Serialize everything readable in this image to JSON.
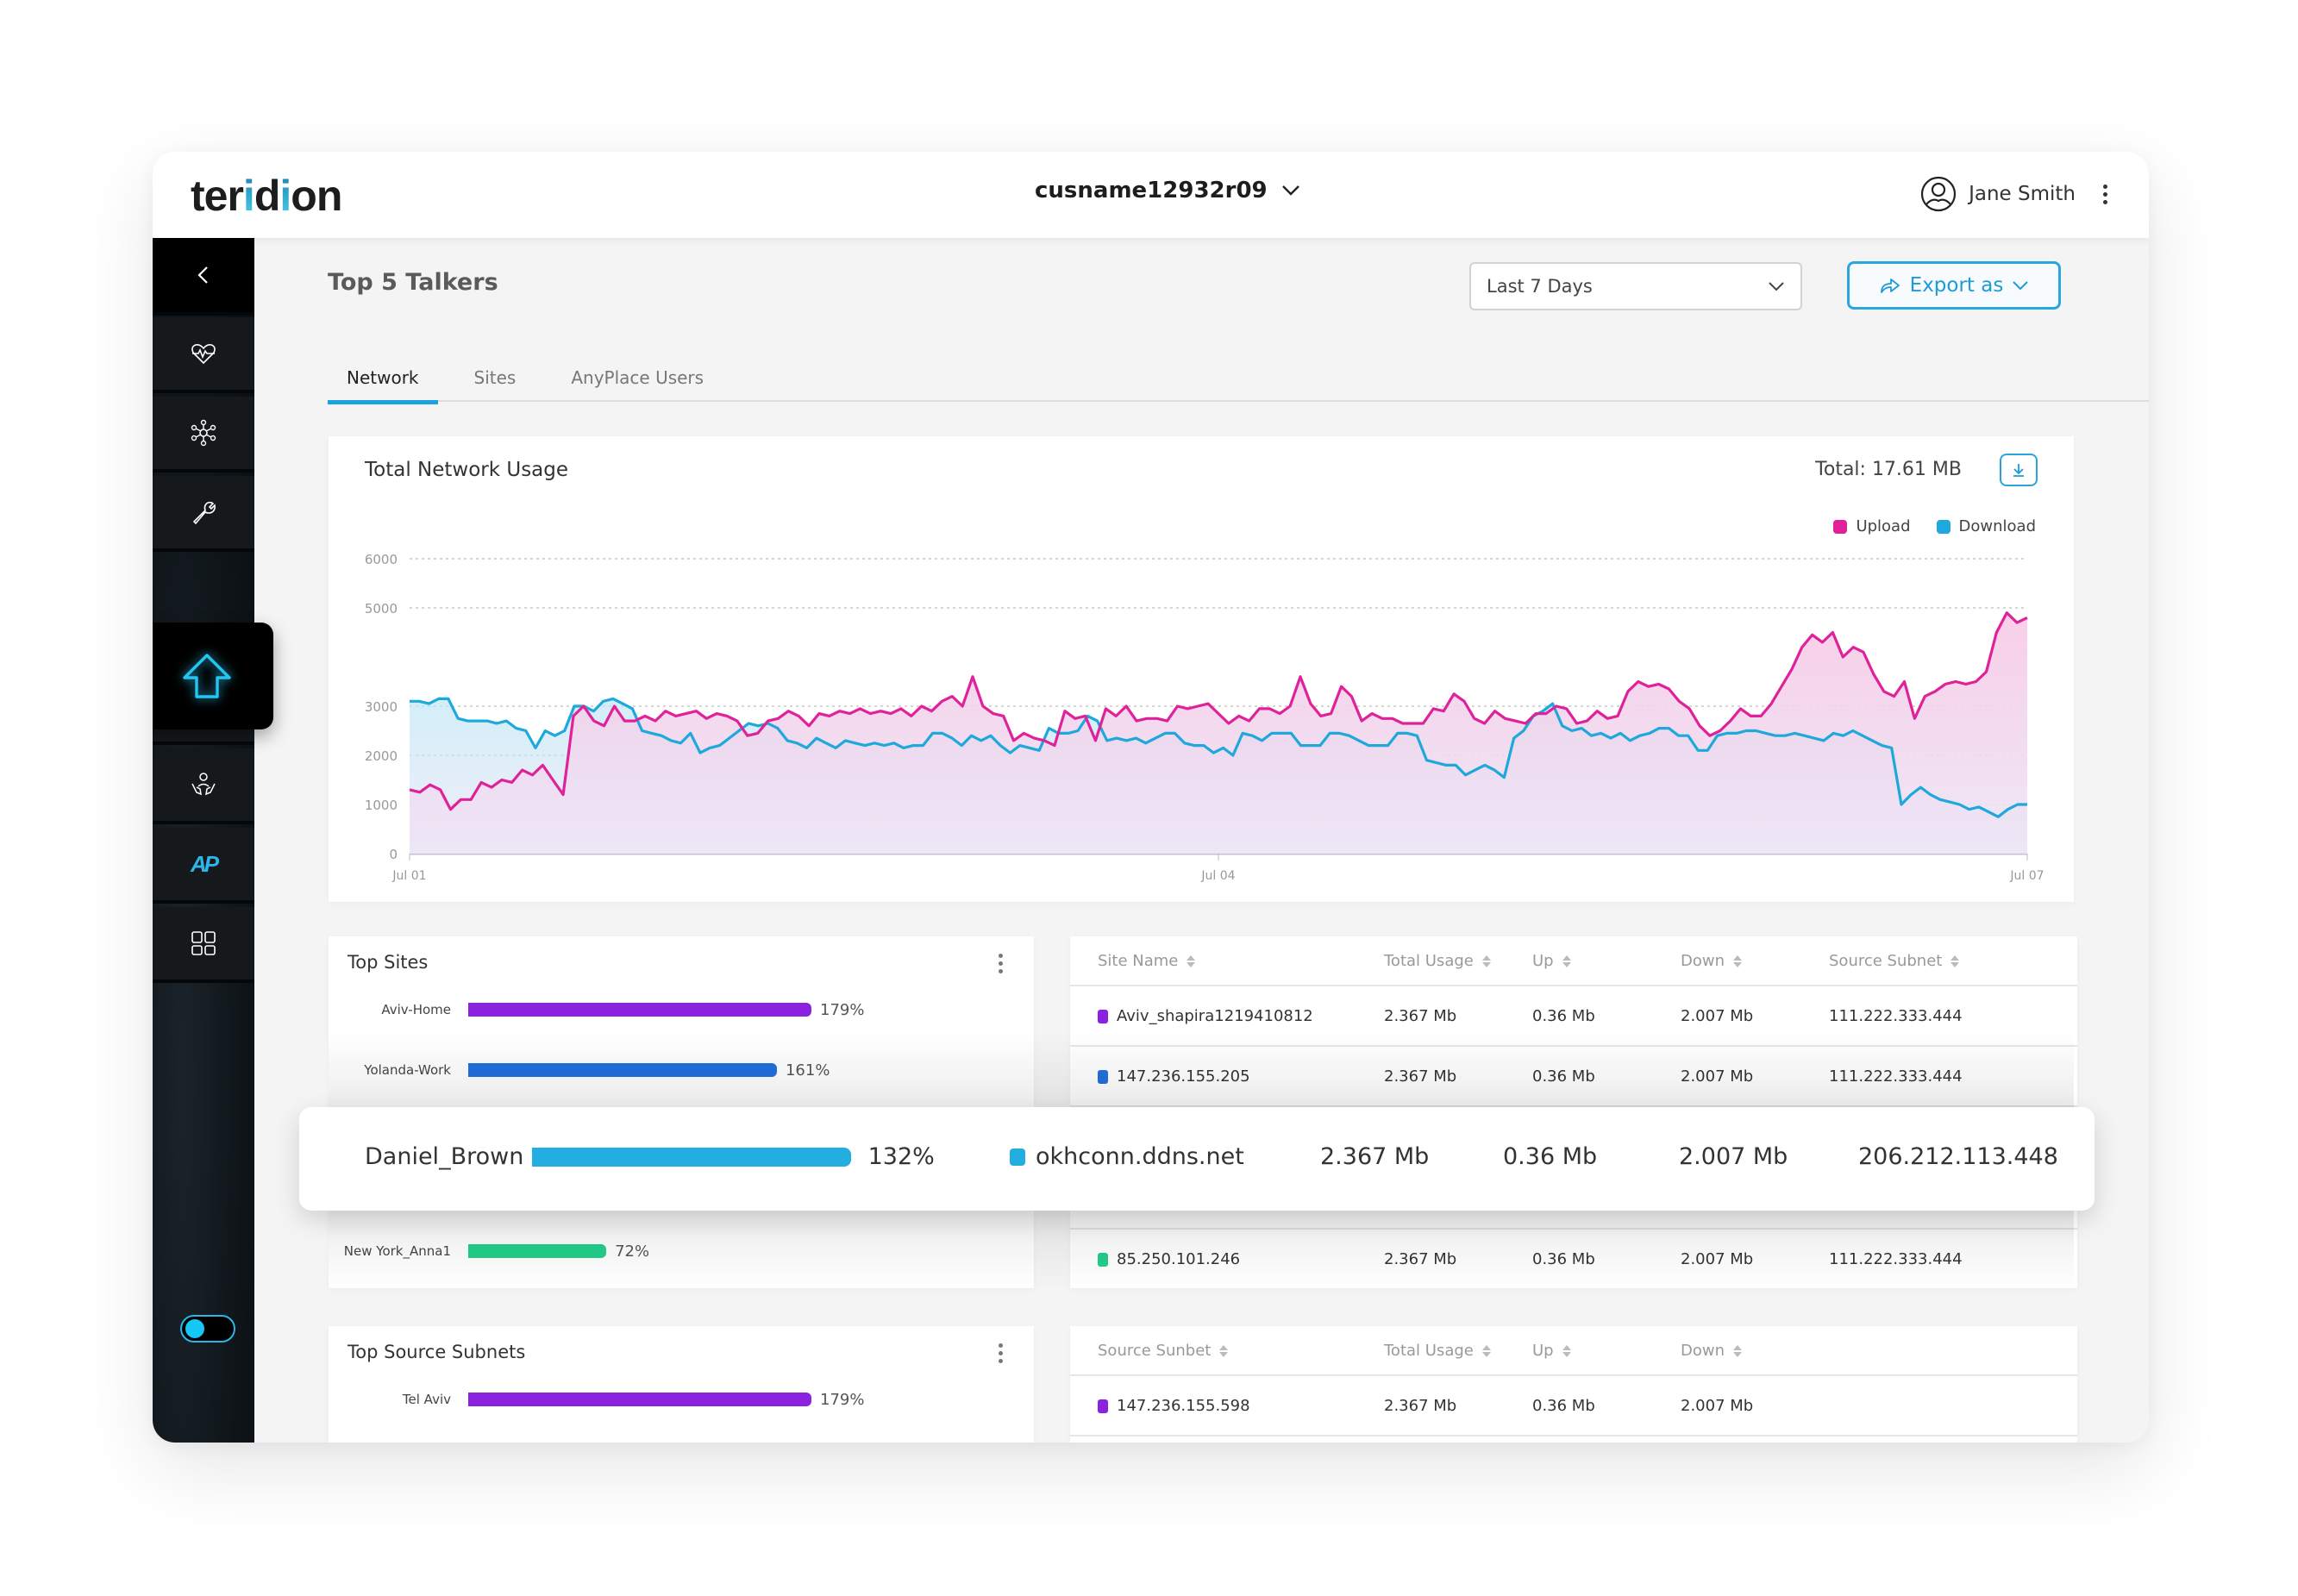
{
  "brand": {
    "name_pre": "ter",
    "name_i1": "i",
    "name_mid": "d",
    "name_i2": "i",
    "name_post": "on"
  },
  "header": {
    "tenant": "cusname12932r09",
    "user_name": "Jane Smith"
  },
  "sidebar": {
    "items": [
      {
        "name": "back",
        "icon": "chevron-left-icon"
      },
      {
        "name": "health",
        "icon": "heart-pulse-icon"
      },
      {
        "name": "network",
        "icon": "network-nodes-icon"
      },
      {
        "name": "tools",
        "icon": "wrench-icon"
      },
      {
        "name": "top-talkers",
        "icon": "arrow-up-icon",
        "active": true
      },
      {
        "name": "users",
        "icon": "users-group-icon"
      },
      {
        "name": "support",
        "icon": "hands-user-icon"
      },
      {
        "name": "anyplace",
        "icon": "ap-logo-icon",
        "label": "AP"
      },
      {
        "name": "apps",
        "icon": "grid-icon"
      }
    ],
    "toggle_on": true
  },
  "page": {
    "title": "Top 5 Talkers",
    "range_select": "Last 7 Days",
    "export_label": "Export as",
    "tabs": [
      {
        "label": "Network",
        "active": true
      },
      {
        "label": "Sites",
        "active": false
      },
      {
        "label": "AnyPlace Users",
        "active": false
      }
    ]
  },
  "network_chart": {
    "title": "Total Network Usage",
    "total": "Total: 17.61 MB"
  },
  "chart_data": {
    "type": "area",
    "title": "Total Network Usage",
    "xlabel": "",
    "ylabel": "",
    "ylim": [
      0,
      6000
    ],
    "yticks": [
      0,
      1000,
      2000,
      3000,
      5000,
      6000
    ],
    "ytick_labels": [
      "0",
      "1000",
      "2000",
      "3000",
      "5000",
      "6000"
    ],
    "x_tick_labels": [
      "Jul 01",
      "Jul 04",
      "Jul 07"
    ],
    "x_tick_positions": [
      0,
      0.5,
      1
    ],
    "grid": true,
    "legend": "top-right",
    "series": [
      {
        "name": "Upload",
        "color": "#e0229a",
        "values": [
          1300,
          1250,
          1400,
          1300,
          900,
          1100,
          1100,
          1450,
          1350,
          1500,
          1450,
          1700,
          1600,
          1800,
          1500,
          1200,
          2800,
          3000,
          2700,
          2600,
          3000,
          2700,
          2700,
          2800,
          2700,
          2900,
          2800,
          2850,
          2900,
          2750,
          2850,
          2800,
          2700,
          2400,
          2450,
          2700,
          2750,
          2900,
          2800,
          2600,
          2850,
          2800,
          2900,
          2850,
          2950,
          2850,
          2900,
          2850,
          2950,
          2800,
          3000,
          2900,
          3100,
          3200,
          3000,
          3600,
          3000,
          2850,
          2800,
          2300,
          2450,
          2350,
          2300,
          2200,
          2900,
          2750,
          2800,
          2300,
          2950,
          2800,
          3000,
          2700,
          2750,
          2750,
          2700,
          3000,
          2950,
          3000,
          3050,
          2850,
          2650,
          2800,
          2700,
          2950,
          2950,
          2850,
          3000,
          3600,
          3050,
          2800,
          2850,
          3400,
          3200,
          2700,
          2850,
          2750,
          2750,
          2650,
          2650,
          2650,
          2950,
          2900,
          3250,
          3100,
          2750,
          2650,
          2900,
          2750,
          2700,
          2650,
          2850,
          2850,
          3000,
          2950,
          2650,
          2700,
          2900,
          2750,
          2800,
          3300,
          3500,
          3400,
          3450,
          3350,
          3100,
          2950,
          2600,
          2400,
          2500,
          2700,
          2950,
          2800,
          2800,
          3050,
          3400,
          3750,
          4200,
          4450,
          4300,
          4500,
          4000,
          4200,
          4100,
          3650,
          3300,
          3200,
          3500,
          2750,
          3200,
          3300,
          3450,
          3500,
          3450,
          3500,
          3700,
          4500,
          4900,
          4700,
          4800
        ]
      },
      {
        "name": "Download",
        "color": "#1ea8dc",
        "values": [
          3100,
          3100,
          3050,
          3150,
          3150,
          2750,
          2700,
          2700,
          2700,
          2650,
          2700,
          2550,
          2500,
          2150,
          2500,
          2400,
          2500,
          3000,
          3000,
          2900,
          3100,
          3150,
          3050,
          2950,
          2500,
          2450,
          2400,
          2300,
          2250,
          2450,
          2050,
          2150,
          2200,
          2350,
          2500,
          2650,
          2600,
          2650,
          2550,
          2300,
          2250,
          2150,
          2350,
          2250,
          2150,
          2300,
          2250,
          2200,
          2250,
          2200,
          2250,
          2150,
          2200,
          2200,
          2450,
          2450,
          2350,
          2200,
          2400,
          2300,
          2400,
          2200,
          2050,
          2200,
          2150,
          2100,
          2550,
          2450,
          2450,
          2500,
          2800,
          2700,
          2300,
          2350,
          2300,
          2350,
          2250,
          2350,
          2450,
          2450,
          2250,
          2200,
          2200,
          2050,
          2150,
          2000,
          2450,
          2400,
          2300,
          2450,
          2450,
          2450,
          2200,
          2200,
          2200,
          2450,
          2450,
          2400,
          2300,
          2200,
          2200,
          2200,
          2450,
          2450,
          2400,
          1900,
          1850,
          1800,
          1800,
          1600,
          1700,
          1800,
          1700,
          1550,
          2350,
          2500,
          2800,
          2900,
          3050,
          2600,
          2500,
          2550,
          2400,
          2450,
          2350,
          2450,
          2300,
          2400,
          2450,
          2550,
          2550,
          2400,
          2400,
          2100,
          2100,
          2400,
          2450,
          2450,
          2500,
          2500,
          2450,
          2400,
          2400,
          2450,
          2400,
          2350,
          2300,
          2450,
          2400,
          2500,
          2400,
          2300,
          2200,
          2150,
          1000,
          1200,
          1350,
          1200,
          1100,
          1050,
          1000,
          900,
          950,
          850,
          750,
          900,
          1000,
          1000
        ]
      }
    ]
  },
  "top_sites": {
    "title": "Top Sites",
    "bars": [
      {
        "label": "Aviv-Home",
        "value_pct": 179,
        "value_label": "179%",
        "color": "#8a22e0"
      },
      {
        "label": "Yolanda-Work",
        "value_pct": 161,
        "value_label": "161%",
        "color": "#2170dd"
      },
      {
        "label": "New York_Anna1",
        "value_pct": 72,
        "value_label": "72%",
        "color": "#22cf8a"
      }
    ]
  },
  "sites_table": {
    "columns": [
      "Site Name",
      "Total Usage",
      "Up",
      "Down",
      "Source Subnet"
    ],
    "rows": [
      {
        "color": "#8a22e0",
        "name": "Aviv_shapira1219410812",
        "total": "2.367 Mb",
        "up": "0.36 Mb",
        "down": "2.007 Mb",
        "subnet": "111.222.333.444"
      },
      {
        "color": "#2170dd",
        "name": "147.236.155.205",
        "total": "2.367 Mb",
        "up": "0.36 Mb",
        "down": "2.007 Mb",
        "subnet": "111.222.333.444"
      },
      {
        "color": "#22cf8a",
        "name": "85.250.101.246",
        "total": "2.367 Mb",
        "up": "0.36 Mb",
        "down": "2.007 Mb",
        "subnet": "111.222.333.444"
      }
    ]
  },
  "highlight_row": {
    "bar_label": "Daniel_Brown",
    "bar_value_pct": 132,
    "bar_value_label": "132%",
    "color": "#22aee0",
    "name": "okhconn.ddns.net",
    "total": "2.367 Mb",
    "up": "0.36 Mb",
    "down": "2.007 Mb",
    "subnet": "206.212.113.448"
  },
  "top_subnets": {
    "title": "Top Source Subnets",
    "bars": [
      {
        "label": "Tel Aviv",
        "value_pct": 179,
        "value_label": "179%",
        "color": "#8a22e0"
      }
    ]
  },
  "subnets_table": {
    "columns": [
      "Source Sunbet",
      "Total Usage",
      "Up",
      "Down"
    ],
    "rows": [
      {
        "color": "#8a22e0",
        "name": "147.236.155.598",
        "total": "2.367 Mb",
        "up": "0.36 Mb",
        "down": "2.007 Mb"
      }
    ]
  }
}
